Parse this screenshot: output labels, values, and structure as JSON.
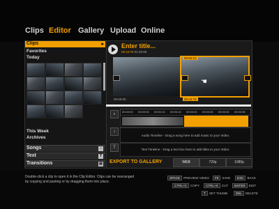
{
  "nav": {
    "items": [
      {
        "label": "Clips",
        "active": false
      },
      {
        "label": "Editor",
        "active": true
      },
      {
        "label": "Gallery",
        "active": false
      },
      {
        "label": "Upload",
        "active": false
      },
      {
        "label": "Online",
        "active": false
      }
    ]
  },
  "sidebar": {
    "clips_label": "Clips",
    "favorites_label": "Favorites",
    "today_label": "Today",
    "this_week_label": "This Week",
    "archives_label": "Archives",
    "songs_label": "Songs",
    "text_label": "Text",
    "transitions_label": "Transitions"
  },
  "editor": {
    "title": "Enter title...",
    "title_time": "00:44:75",
    "title_time2": "01:20:06",
    "clip1_start": "00:00:00",
    "clip2_start": "00:52:21",
    "clip2_end": "00:44:75"
  },
  "timeline": {
    "ticks": [
      "00:00:00",
      "00:00:05",
      "00:00:10",
      "00:00:15",
      "00:00:20",
      "00:00:25",
      "00:00:30",
      "00:00:35"
    ],
    "audio_hint": "Audio Timeline - Drag a song here to add music to your Video.",
    "text_hint": "Text Timeline - Drag a text box here to add titles to your Video."
  },
  "export": {
    "label": "EXPORT TO GALLERY",
    "quality": [
      "WEB",
      "720p",
      "1080p"
    ],
    "selected": "WEB"
  },
  "footer": {
    "help": "Double-click a clip to open it in the Clip Editor. Clips can be rearranged by copying and pasting or by dragging them into place.",
    "keys": [
      {
        "key": "SPACE",
        "label": "PREVIEW VIDEO"
      },
      {
        "key": "F5",
        "label": "SAVE"
      },
      {
        "key": "ESC",
        "label": "BACK"
      },
      {
        "key": "CTRL+C",
        "label": "COPY"
      },
      {
        "key": "CTRL+X",
        "label": "CUT"
      },
      {
        "key": "ENTER",
        "label": "EDIT"
      },
      {
        "key": "T",
        "label": "SET THUMB"
      },
      {
        "key": "DEL",
        "label": "DELETE"
      }
    ]
  },
  "colors": {
    "accent": "#f2a000",
    "background": "#0b0b0b"
  }
}
